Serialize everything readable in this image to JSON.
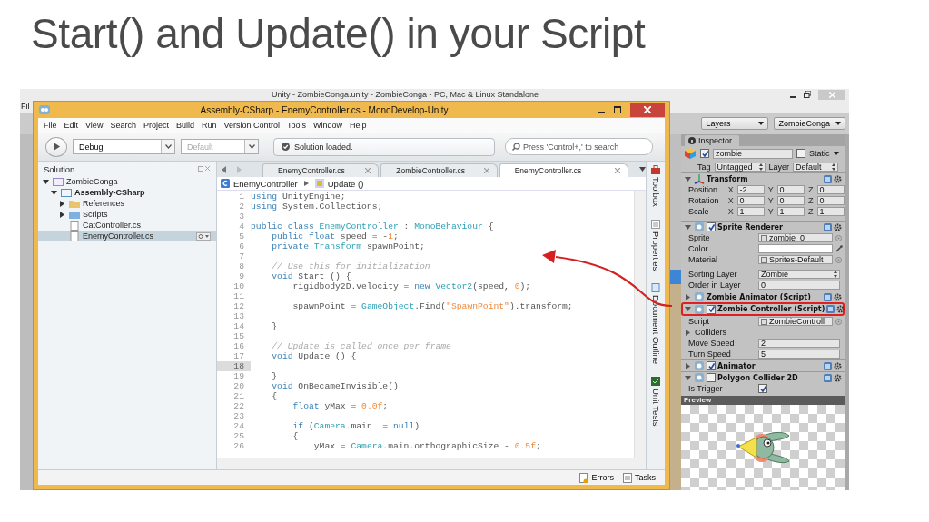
{
  "slide_title": "Start() and Update() in your Script",
  "unity": {
    "title": "Unity - ZombieConga.unity - ZombieConga - PC, Mac & Linux Standalone",
    "menu_fragment": "Fil",
    "layers": "Layers",
    "layout": "ZombieConga",
    "inspector": {
      "tab": "Inspector",
      "object": {
        "name": "zombie",
        "active": true,
        "static_label": "Static",
        "static": false
      },
      "tag_label": "Tag",
      "tag": "Untagged",
      "layer_label": "Layer",
      "layer": "Default",
      "components": [
        {
          "kind": "transform",
          "name": "Transform",
          "expanded": true,
          "highlighted": false,
          "rows": [
            {
              "label": "Position",
              "fields": [
                {
                  "axis": "X",
                  "value": "-2"
                },
                {
                  "axis": "Y",
                  "value": "0"
                },
                {
                  "axis": "Z",
                  "value": "0"
                }
              ]
            },
            {
              "label": "Rotation",
              "fields": [
                {
                  "axis": "X",
                  "value": "0"
                },
                {
                  "axis": "Y",
                  "value": "0"
                },
                {
                  "axis": "Z",
                  "value": "0"
                }
              ]
            },
            {
              "label": "Scale",
              "fields": [
                {
                  "axis": "X",
                  "value": "1"
                },
                {
                  "axis": "Y",
                  "value": "1"
                },
                {
                  "axis": "Z",
                  "value": "1"
                }
              ]
            }
          ]
        },
        {
          "kind": "component",
          "name": "Sprite Renderer",
          "enabled": true,
          "expanded": true,
          "highlighted": false,
          "properties": [
            {
              "label": "Sprite",
              "kind": "object",
              "value": "zombie_0"
            },
            {
              "label": "Color",
              "kind": "color"
            },
            {
              "label": "Material",
              "kind": "object",
              "value": "Sprites-Default"
            },
            {
              "label": "Sorting Layer",
              "kind": "dropdown",
              "value": "Zombie"
            },
            {
              "label": "Order in Layer",
              "kind": "number",
              "value": "0"
            }
          ]
        },
        {
          "kind": "component",
          "name": "Zombie Animator (Script)",
          "expanded": false,
          "highlighted": false
        },
        {
          "kind": "component",
          "name": "Zombie Controller (Script)",
          "enabled": true,
          "expanded": true,
          "highlighted": true,
          "properties": [
            {
              "label": "Script",
              "kind": "object",
              "value": "ZombieControll"
            },
            {
              "label": "Colliders",
              "kind": "foldout"
            },
            {
              "label": "Move Speed",
              "kind": "number",
              "value": "2"
            },
            {
              "label": "Turn Speed",
              "kind": "number",
              "value": "5"
            }
          ]
        },
        {
          "kind": "component",
          "name": "Animator",
          "enabled": true,
          "expanded": false,
          "highlighted": false
        },
        {
          "kind": "component",
          "name": "Polygon Collider 2D",
          "enabled": false,
          "expanded": true,
          "highlighted": false,
          "properties": [
            {
              "label": "Is Trigger",
              "kind": "checkbox",
              "checked": true
            }
          ]
        }
      ],
      "preview": "Preview"
    }
  },
  "monodevelop": {
    "title": "Assembly-CSharp - EnemyController.cs - MonoDevelop-Unity",
    "menu": [
      "File",
      "Edit",
      "View",
      "Search",
      "Project",
      "Build",
      "Run",
      "Version Control",
      "Tools",
      "Window",
      "Help"
    ],
    "toolbar": {
      "configuration": "Debug",
      "platform": {
        "value": "Default",
        "disabled": true
      },
      "status": "Solution loaded.",
      "search": {
        "placeholder": "Press 'Control+,' to search"
      }
    },
    "solution": {
      "title": "Solution",
      "items": [
        {
          "label": "ZombieConga",
          "kind": "solution",
          "expanded": true,
          "selected": false,
          "children": [
            {
              "label": "Assembly-CSharp",
              "kind": "project",
              "expanded": true,
              "selected": false,
              "children": [
                {
                  "label": "References",
                  "kind": "folder",
                  "expanded": false,
                  "selected": false
                },
                {
                  "label": "Scripts",
                  "kind": "folder",
                  "expanded": false,
                  "selected": false
                },
                {
                  "label": "CatController.cs",
                  "kind": "file",
                  "selected": false
                },
                {
                  "label": "EnemyController.cs",
                  "kind": "file",
                  "selected": true
                }
              ]
            }
          ]
        }
      ]
    },
    "editor": {
      "tabs": [
        {
          "label": "EnemyController.cs",
          "selected": false
        },
        {
          "label": "ZombieController.cs",
          "selected": false
        },
        {
          "label": "EnemyController.cs",
          "selected": true
        }
      ],
      "breadcrumb": [
        "EnemyController",
        "Update ()"
      ],
      "lines": [
        {
          "number": "1",
          "current": false,
          "segments": [
            {
              "text": "using",
              "kind": "keyword"
            },
            {
              "text": " UnityEngine;",
              "kind": "plain"
            }
          ]
        },
        {
          "number": "2",
          "current": false,
          "segments": [
            {
              "text": "using",
              "kind": "keyword"
            },
            {
              "text": " System.Collections;",
              "kind": "plain"
            }
          ]
        },
        {
          "number": "3",
          "current": false
        },
        {
          "number": "4",
          "current": false,
          "segments": [
            {
              "text": "public class",
              "kind": "keyword"
            },
            {
              "text": " EnemyController",
              "kind": "type"
            },
            {
              "text": " : ",
              "kind": "plain"
            },
            {
              "text": "MonoBehaviour",
              "kind": "type"
            },
            {
              "text": " {",
              "kind": "plain"
            }
          ]
        },
        {
          "number": "5",
          "current": false,
          "segments": [
            {
              "text": "    public float",
              "kind": "keyword"
            },
            {
              "text": " speed = -",
              "kind": "plain"
            },
            {
              "text": "1",
              "kind": "number"
            },
            {
              "text": ";",
              "kind": "plain"
            }
          ]
        },
        {
          "number": "6",
          "current": false,
          "segments": [
            {
              "text": "    private",
              "kind": "keyword"
            },
            {
              "text": " Transform",
              "kind": "type"
            },
            {
              "text": " spawnPoint;",
              "kind": "plain"
            }
          ]
        },
        {
          "number": "7",
          "current": false
        },
        {
          "number": "8",
          "current": false,
          "segments": [
            {
              "text": "    // Use this for initialization",
              "kind": "comment"
            }
          ]
        },
        {
          "number": "9",
          "current": false,
          "segments": [
            {
              "text": "    void",
              "kind": "keyword"
            },
            {
              "text": " Start () {",
              "kind": "plain"
            }
          ]
        },
        {
          "number": "10",
          "current": false,
          "segments": [
            {
              "text": "        rigidbody2D.velocity = ",
              "kind": "plain"
            },
            {
              "text": "new",
              "kind": "keyword"
            },
            {
              "text": " Vector2",
              "kind": "type"
            },
            {
              "text": "(speed, ",
              "kind": "plain"
            },
            {
              "text": "0",
              "kind": "number"
            },
            {
              "text": ");",
              "kind": "plain"
            }
          ]
        },
        {
          "number": "11",
          "current": false
        },
        {
          "number": "12",
          "current": false,
          "segments": [
            {
              "text": "        spawnPoint = ",
              "kind": "plain"
            },
            {
              "text": "GameObject",
              "kind": "type"
            },
            {
              "text": ".Find(",
              "kind": "plain"
            },
            {
              "text": "\"SpawnPoint\"",
              "kind": "string"
            },
            {
              "text": ").transform;",
              "kind": "plain"
            }
          ]
        },
        {
          "number": "13",
          "current": false
        },
        {
          "number": "14",
          "current": false,
          "segments": [
            {
              "text": "    }",
              "kind": "plain"
            }
          ]
        },
        {
          "number": "15",
          "current": false
        },
        {
          "number": "16",
          "current": false,
          "segments": [
            {
              "text": "    // Update is called once per frame",
              "kind": "comment"
            }
          ]
        },
        {
          "number": "17",
          "current": false,
          "segments": [
            {
              "text": "    void",
              "kind": "keyword"
            },
            {
              "text": " Update () {",
              "kind": "plain"
            }
          ]
        },
        {
          "number": "18",
          "current": true
        },
        {
          "number": "19",
          "current": false,
          "segments": [
            {
              "text": "    }",
              "kind": "plain"
            }
          ]
        },
        {
          "number": "20",
          "current": false,
          "segments": [
            {
              "text": "    void",
              "kind": "keyword"
            },
            {
              "text": " OnBecameInvisible()",
              "kind": "plain"
            }
          ]
        },
        {
          "number": "21",
          "current": false,
          "segments": [
            {
              "text": "    {",
              "kind": "plain"
            }
          ]
        },
        {
          "number": "22",
          "current": false,
          "segments": [
            {
              "text": "        float",
              "kind": "keyword"
            },
            {
              "text": " yMax = ",
              "kind": "plain"
            },
            {
              "text": "0.0f",
              "kind": "number"
            },
            {
              "text": ";",
              "kind": "plain"
            }
          ]
        },
        {
          "number": "23",
          "current": false
        },
        {
          "number": "24",
          "current": false,
          "segments": [
            {
              "text": "        if",
              "kind": "keyword"
            },
            {
              "text": " (",
              "kind": "plain"
            },
            {
              "text": "Camera",
              "kind": "type"
            },
            {
              "text": ".main != ",
              "kind": "plain"
            },
            {
              "text": "null",
              "kind": "keyword"
            },
            {
              "text": ")",
              "kind": "plain"
            }
          ]
        },
        {
          "number": "25",
          "current": false,
          "segments": [
            {
              "text": "        {",
              "kind": "plain"
            }
          ]
        },
        {
          "number": "26",
          "current": false,
          "segments": [
            {
              "text": "            yMax = ",
              "kind": "plain"
            },
            {
              "text": "Camera",
              "kind": "type"
            },
            {
              "text": ".main.orthographicSize - ",
              "kind": "plain"
            },
            {
              "text": "0.5f",
              "kind": "number"
            },
            {
              "text": ";",
              "kind": "plain"
            }
          ]
        }
      ]
    },
    "pads": [
      "Toolbox",
      "Properties",
      "Document Outline",
      "Unit Tests"
    ],
    "status_bar": [
      "Errors",
      "Tasks"
    ]
  }
}
